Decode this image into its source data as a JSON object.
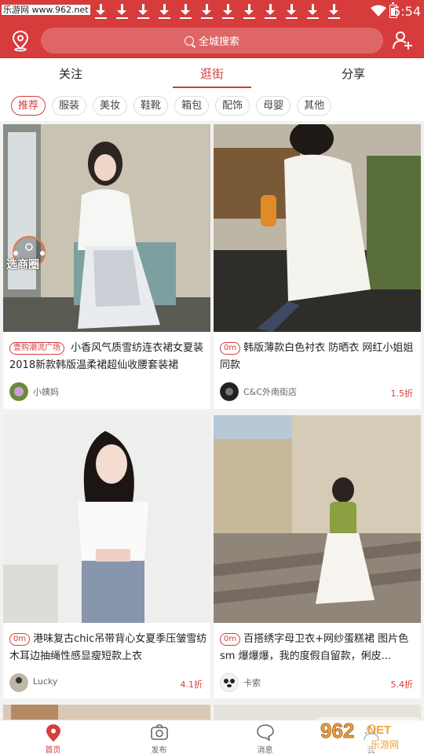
{
  "status_bar": {
    "watermark": "乐游网 www.962.net",
    "time": "5:54"
  },
  "header": {
    "search_placeholder": "全城搜索"
  },
  "tabs": [
    {
      "label": "关注",
      "active": false
    },
    {
      "label": "逛街",
      "active": true
    },
    {
      "label": "分享",
      "active": false
    }
  ],
  "categories": [
    "推荐",
    "服装",
    "美妆",
    "鞋靴",
    "箱包",
    "配饰",
    "母婴",
    "其他"
  ],
  "selected_category": "推荐",
  "cards": [
    {
      "tag": "壹购潮流广场",
      "title": "小香风气质雪纺连衣裙女夏装2018新款韩版温柔裙超仙收腰套装裙",
      "user": "小姨妈",
      "discount": "",
      "badge": "选商圈"
    },
    {
      "tag": "0m",
      "title": "韩版薄款白色衬衣 防晒衣 网红小姐姐同款",
      "user": "C&C外南街店",
      "discount": "1.5折"
    },
    {
      "tag": "0m",
      "title": "港味复古chic吊带背心女夏季压皱雪纺木耳边抽绳性感显瘦短款上衣",
      "user": "Lucky",
      "discount": "4.1折"
    },
    {
      "tag": "0m",
      "title": "百搭绣字母卫衣+网纱蛋糕裙 图片色sm 爆爆爆，我的度假自留款，俐皮...",
      "user": "卡索",
      "discount": "5.4折"
    }
  ],
  "bottom_nav": [
    {
      "label": "首页",
      "icon": "home-pin-icon",
      "active": true
    },
    {
      "label": "发布",
      "icon": "camera-icon",
      "active": false
    },
    {
      "label": "消息",
      "icon": "chat-bubble-icon",
      "active": false
    },
    {
      "label": "我",
      "icon": "profile-icon",
      "active": false
    }
  ],
  "corner_watermark": {
    "main": "962",
    "suffix": ".NET",
    "sub": "乐游网"
  },
  "colors": {
    "brand_red": "#d63c3c",
    "background": "#f2f2f2"
  }
}
